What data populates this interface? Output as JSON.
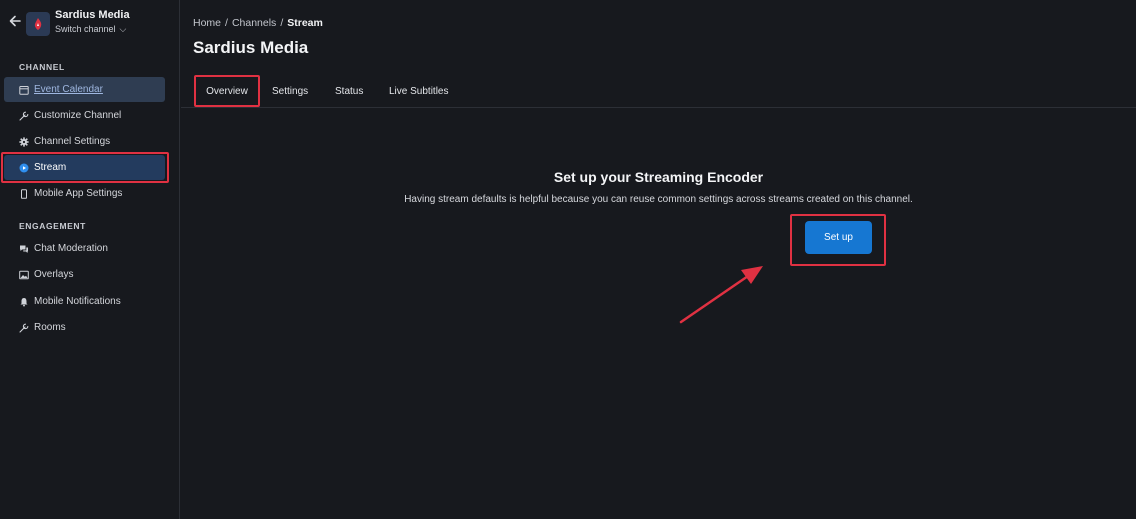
{
  "channel": {
    "name": "Sardius Media",
    "switch_label": "Switch channel"
  },
  "sidebar": {
    "sections": [
      {
        "label": "CHANNEL",
        "items": [
          {
            "label": "Event Calendar",
            "icon": "calendar-icon"
          },
          {
            "label": "Customize Channel",
            "icon": "wrench-icon"
          },
          {
            "label": "Channel Settings",
            "icon": "gear-icon"
          },
          {
            "label": "Stream",
            "icon": "play-circle-icon"
          },
          {
            "label": "Mobile App Settings",
            "icon": "mobile-icon"
          }
        ]
      },
      {
        "label": "ENGAGEMENT",
        "items": [
          {
            "label": "Chat Moderation",
            "icon": "chat-icon"
          },
          {
            "label": "Overlays",
            "icon": "image-icon"
          },
          {
            "label": "Mobile Notifications",
            "icon": "bell-icon"
          },
          {
            "label": "Rooms",
            "icon": "wrench-icon"
          }
        ]
      }
    ]
  },
  "breadcrumb": {
    "items": [
      "Home",
      "Channels"
    ],
    "current": "Stream",
    "separator": "/"
  },
  "page": {
    "title": "Sardius Media"
  },
  "tabs": [
    {
      "label": "Overview"
    },
    {
      "label": "Settings"
    },
    {
      "label": "Status"
    },
    {
      "label": "Live Subtitles"
    }
  ],
  "empty_state": {
    "title": "Set up your Streaming Encoder",
    "description": "Having stream defaults is helpful because you can reuse common settings across streams created on this channel.",
    "button_label": "Set up"
  },
  "colors": {
    "background": "#17191e",
    "accent": "#1677d2",
    "highlight": "#e03142",
    "active_nav": "#233b5e"
  }
}
